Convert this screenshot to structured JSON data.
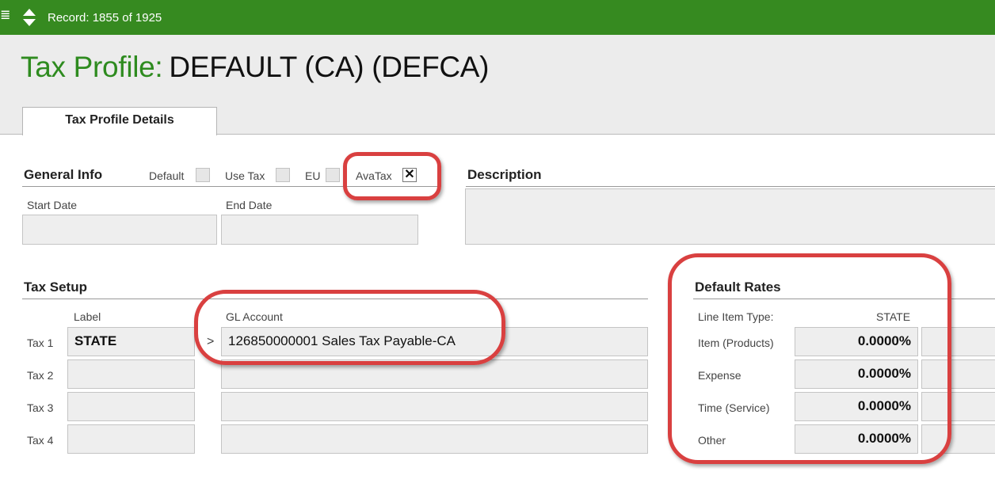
{
  "toolbar": {
    "record_text": "Record: 1855 of 1925"
  },
  "page": {
    "title_label": "Tax Profile:",
    "title_value": "DEFAULT (CA)  (DEFCA)"
  },
  "tabs": [
    {
      "label": "Tax Profile Details",
      "active": true
    }
  ],
  "general_info": {
    "heading": "General Info",
    "flags": [
      {
        "label": "Default",
        "checked": false
      },
      {
        "label": "Use Tax",
        "checked": false
      },
      {
        "label": "EU",
        "checked": false
      },
      {
        "label": "AvaTax",
        "checked": true,
        "mark": "✕"
      }
    ],
    "start_date_label": "Start Date",
    "start_date": "",
    "end_date_label": "End Date",
    "end_date": ""
  },
  "description": {
    "heading": "Description",
    "value": ""
  },
  "tax_setup": {
    "heading": "Tax Setup",
    "label_header": "Label",
    "gl_header": "GL Account",
    "arrow": ">",
    "rows": [
      {
        "name": "Tax 1",
        "label": "STATE",
        "gl_account": "126850000001 Sales Tax Payable-CA"
      },
      {
        "name": "Tax 2",
        "label": "",
        "gl_account": ""
      },
      {
        "name": "Tax 3",
        "label": "",
        "gl_account": ""
      },
      {
        "name": "Tax 4",
        "label": "",
        "gl_account": ""
      }
    ]
  },
  "default_rates": {
    "heading": "Default Rates",
    "type_header": "Line Item Type:",
    "column_header": "STATE",
    "rows": [
      {
        "type": "Item (Products)",
        "rate": "0.0000%"
      },
      {
        "type": "Expense",
        "rate": "0.0000%"
      },
      {
        "type": "Time (Service)",
        "rate": "0.0000%"
      },
      {
        "type": "Other",
        "rate": "0.0000%"
      }
    ]
  },
  "colors": {
    "topbar": "#368a20",
    "title_label": "#2e8b1f",
    "highlight": "#d94040"
  }
}
